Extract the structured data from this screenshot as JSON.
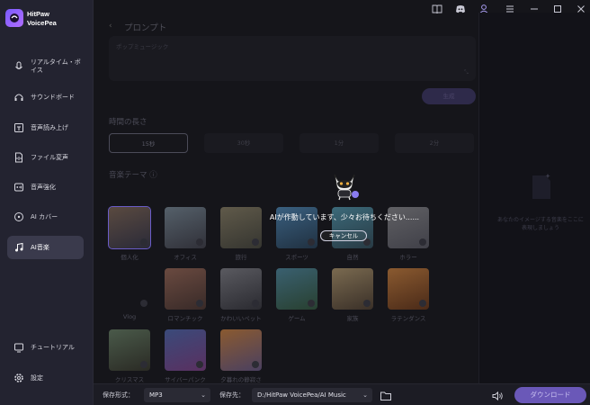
{
  "brand": {
    "line1": "HitPaw",
    "line2": "VoicePea"
  },
  "sidebar": {
    "items": [
      {
        "label": "リアルタイム・ボイス",
        "icon": "microphone-icon"
      },
      {
        "label": "サウンドボード",
        "icon": "headphones-icon"
      },
      {
        "label": "音声読み上げ",
        "icon": "text-to-speech-icon"
      },
      {
        "label": "ファイル変声",
        "icon": "file-voice-icon"
      },
      {
        "label": "音声強化",
        "icon": "voice-enhance-icon"
      },
      {
        "label": "AI カバー",
        "icon": "ai-cover-icon"
      },
      {
        "label": "AI音楽",
        "icon": "ai-music-icon",
        "active": true
      }
    ],
    "bottom": [
      {
        "label": "チュートリアル",
        "icon": "tutorial-icon"
      },
      {
        "label": "設定",
        "icon": "settings-icon"
      }
    ]
  },
  "main": {
    "prompt_title": "プロンプト",
    "prompt_placeholder": "ポップミュージック",
    "generate_label": "生成",
    "length_title": "時間の長さ",
    "lengths": [
      "15秒",
      "30秒",
      "1分",
      "2分"
    ],
    "theme_title": "音楽テーマ ⓘ",
    "themes": [
      {
        "label": "個人化",
        "colors": [
          "#5a4a40",
          "#2a2a38"
        ],
        "selected": true
      },
      {
        "label": "オフィス",
        "colors": [
          "#55606a",
          "#303038"
        ]
      },
      {
        "label": "旅行",
        "colors": [
          "#605a4a",
          "#353530"
        ]
      },
      {
        "label": "スポーツ",
        "colors": [
          "#3a6080",
          "#203040"
        ]
      },
      {
        "label": "自然",
        "colors": [
          "#3c6a7a",
          "#283a44"
        ]
      },
      {
        "label": "ホラー",
        "colors": [
          "#606064",
          "#404048"
        ]
      },
      {
        "label": "Vlog",
        "colors": [
          "#15151a",
          "#15151a"
        ]
      },
      {
        "label": "ロマンチック",
        "colors": [
          "#6a4a40",
          "#382a28"
        ]
      },
      {
        "label": "かわいいペット",
        "colors": [
          "#5a5a60",
          "#2a2a30"
        ]
      },
      {
        "label": "ゲーム",
        "colors": [
          "#3a6070",
          "#284030"
        ]
      },
      {
        "label": "家族",
        "colors": [
          "#7a6a50",
          "#3a3028"
        ]
      },
      {
        "label": "ラテンダンス",
        "colors": [
          "#8a5a30",
          "#4a2a18"
        ]
      },
      {
        "label": "クリスマス",
        "colors": [
          "#4a5a4a",
          "#2a2a24"
        ]
      },
      {
        "label": "サイバーパンク",
        "colors": [
          "#3a4a7a",
          "#5a3060"
        ]
      },
      {
        "label": "夕暮れの静寂さ",
        "colors": [
          "#8a5a30",
          "#4a4060"
        ]
      }
    ]
  },
  "right_panel": {
    "text": "あなたのイメージする音楽をここに表現しましょう"
  },
  "overlay": {
    "loading_text": "AIが作動しています、少々お待ちください......",
    "cancel_label": "キャンセル"
  },
  "bottombar": {
    "format_label": "保存形式：",
    "format_value": "MP3",
    "save_label": "保存先：",
    "save_path": "D:/HitPaw VoicePea/AI Music",
    "download_label": "ダウンロード"
  },
  "colors": {
    "accent": "#6a58b8",
    "sidebar_bg": "#232330",
    "active_nav": "#3a3a4c"
  }
}
